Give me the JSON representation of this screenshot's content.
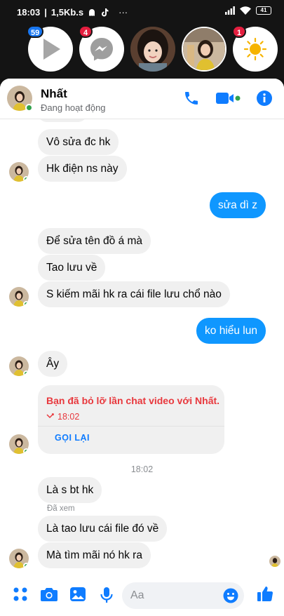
{
  "status_bar": {
    "time": "18:03",
    "speed": "1,5Kb.s",
    "more": "···",
    "battery": "41"
  },
  "chat_heads": [
    {
      "name": "video-app",
      "badge": "59",
      "badge_color": "#1877f2"
    },
    {
      "name": "messenger",
      "badge": "4",
      "badge_color": "#e41e3f"
    },
    {
      "name": "contact-girl",
      "badge": null
    },
    {
      "name": "contact-nhat",
      "badge": null
    },
    {
      "name": "brightness",
      "badge": "1",
      "badge_color": "#e41e3f"
    }
  ],
  "header": {
    "name": "Nhất",
    "status": "Đang hoạt động"
  },
  "messages": [
    {
      "type": "in",
      "text": "Vô sửa đc hk"
    },
    {
      "type": "in",
      "text": "Hk điện ns này"
    },
    {
      "type": "out",
      "text": "sửa dì z"
    },
    {
      "type": "in",
      "text": "Để sửa tên đồ á mà"
    },
    {
      "type": "in",
      "text": "Tao lưu về"
    },
    {
      "type": "in",
      "text": "S kiếm mãi hk ra cái file lưu chổ nào"
    },
    {
      "type": "out",
      "text": "ko hiểu lun"
    },
    {
      "type": "in",
      "text": "Ây"
    },
    {
      "type": "in",
      "text": "Là s bt hk"
    },
    {
      "type": "in",
      "text": "Là tao lưu cái file đó về"
    },
    {
      "type": "in",
      "text": "Mà tìm mãi nó hk ra"
    }
  ],
  "missed_call": {
    "title": "Bạn đã bỏ lỡ lần chat video với Nhất.",
    "time": "18:02",
    "action": "GỌI LẠI"
  },
  "timestamp": "18:02",
  "seen_label": "Đã xem",
  "composer": {
    "placeholder": "Aa"
  },
  "colors": {
    "accent": "#0f97ff",
    "missed": "#e8383d",
    "online": "#31a24c"
  }
}
